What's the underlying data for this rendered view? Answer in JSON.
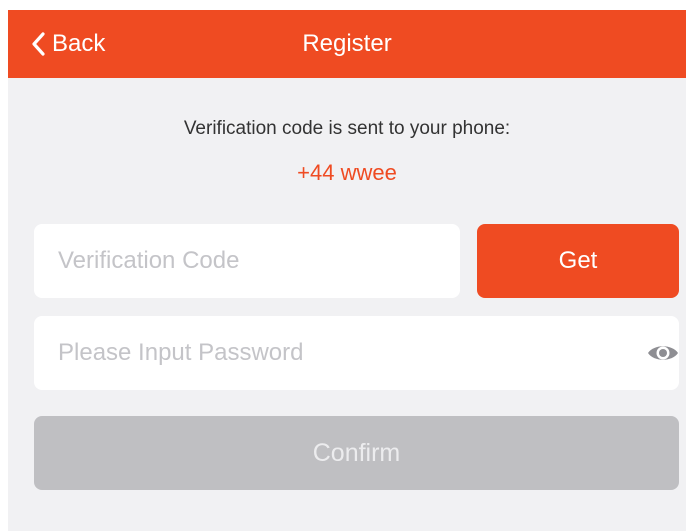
{
  "navbar": {
    "back_label": "Back",
    "title": "Register",
    "back_icon": "chevron-left-icon"
  },
  "info": {
    "message": "Verification code is sent to your phone:",
    "phone": "+44 wwee"
  },
  "form": {
    "code_placeholder": "Verification Code",
    "code_value": "",
    "get_label": "Get",
    "password_placeholder": "Please Input Password",
    "password_value": "",
    "visibility_icon": "eye-icon",
    "confirm_label": "Confirm"
  },
  "colors": {
    "accent": "#ef4b22",
    "background": "#f1f1f3",
    "disabled_button": "#bfbfc2"
  }
}
